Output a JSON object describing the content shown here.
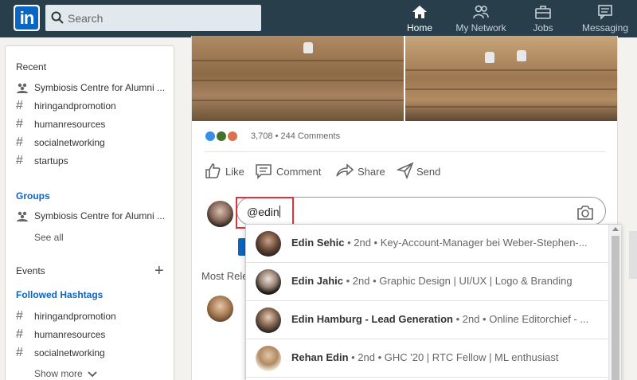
{
  "nav": {
    "logo_text": "in",
    "search_placeholder": "Search",
    "items": [
      {
        "label": "Home",
        "icon": "home-icon"
      },
      {
        "label": "My Network",
        "icon": "network-icon"
      },
      {
        "label": "Jobs",
        "icon": "briefcase-icon"
      },
      {
        "label": "Messaging",
        "icon": "messaging-icon"
      }
    ]
  },
  "sidebar": {
    "recent_title": "Recent",
    "recent": [
      {
        "icon": "group-icon",
        "label": "Symbiosis Centre for Alumni ..."
      },
      {
        "icon": "hashtag-icon",
        "label": "hiringandpromotion"
      },
      {
        "icon": "hashtag-icon",
        "label": "humanresources"
      },
      {
        "icon": "hashtag-icon",
        "label": "socialnetworking"
      },
      {
        "icon": "hashtag-icon",
        "label": "startups"
      }
    ],
    "groups_title": "Groups",
    "groups": [
      {
        "icon": "group-icon",
        "label": "Symbiosis Centre for Alumni ..."
      }
    ],
    "see_all": "See all",
    "events_title": "Events",
    "followed_title": "Followed Hashtags",
    "followed": [
      {
        "icon": "hashtag-icon",
        "label": "hiringandpromotion"
      },
      {
        "icon": "hashtag-icon",
        "label": "humanresources"
      },
      {
        "icon": "hashtag-icon",
        "label": "socialnetworking"
      }
    ],
    "show_more": "Show more"
  },
  "post": {
    "reactions_text": "3,708 • 244 Comments",
    "actions": {
      "like": "Like",
      "comment": "Comment",
      "share": "Share",
      "send": "Send"
    },
    "comment_value": "@edin",
    "most_relevant": "Most Rele"
  },
  "mentions": [
    {
      "name": "Edin Sehic",
      "detail": " • 2nd • Key-Account-Manager bei Weber-Stephen-..."
    },
    {
      "name": "Edin Jahic",
      "detail": " • 2nd • Graphic Design | UI/UX | Logo & Branding"
    },
    {
      "name": "Edin Hamburg - Lead Generation",
      "detail": " • 2nd • Online Editorchief - ..."
    },
    {
      "name": "Rehan Edin",
      "detail": " • 2nd • GHC '20 | RTC Fellow | ML enthusiast"
    }
  ],
  "colors": {
    "nav_bg": "#283e4a",
    "brand_blue": "#0a66c2",
    "highlight_red": "#e2313a"
  }
}
